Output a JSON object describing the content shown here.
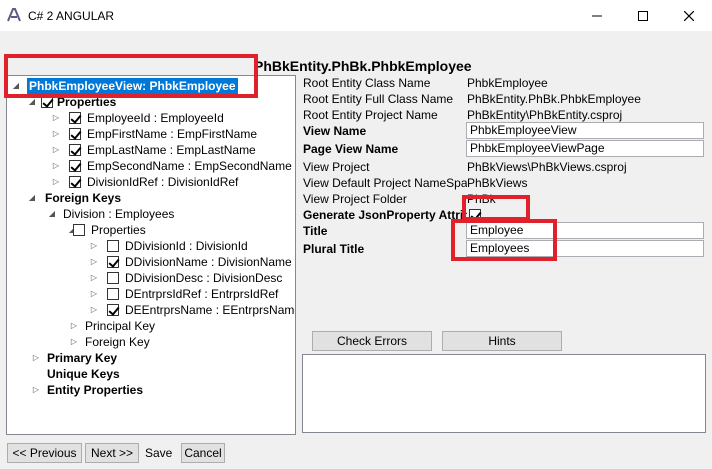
{
  "window": {
    "title": "C# 2 ANGULAR",
    "controls": {
      "minimize": "minimize-icon",
      "maximize": "maximize-icon",
      "close": "close-icon"
    }
  },
  "tree": {
    "root": "PhbkEmployeeView: PhbkEmployee",
    "properties_label": "Properties",
    "properties": [
      "EmployeeId : EmployeeId",
      "EmpFirstName : EmpFirstName",
      "EmpLastName : EmpLastName",
      "EmpSecondName : EmpSecondName",
      "DivisionIdRef : DivisionIdRef"
    ],
    "foreign_keys_label": "Foreign Keys",
    "division_label": "Division : Employees",
    "division_properties_label": "Properties",
    "division_properties": [
      {
        "label": "DDivisionId : DivisionId",
        "checked": false
      },
      {
        "label": "DDivisionName : DivisionName",
        "checked": true
      },
      {
        "label": "DDivisionDesc : DivisionDesc",
        "checked": false
      },
      {
        "label": "DEntrprsIdRef : EntrprsIdRef",
        "checked": false
      },
      {
        "label": "DEEntrprsName : EEntrprsName",
        "checked": true
      }
    ],
    "principal_key_label": "Principal Key",
    "division_foreign_key_label": "Foreign Key",
    "primary_key_label": "Primary Key",
    "unique_keys_label": "Unique Keys",
    "entity_properties_label": "Entity Properties"
  },
  "details": {
    "header": "PhBkEntity.PhBk.PhbkEmployee",
    "root_entity_class_name_label": "Root Entity Class Name",
    "root_entity_class_name": "PhbkEmployee",
    "root_entity_full_class_name_label": "Root Entity Full Class Name",
    "root_entity_full_class_name": "PhBkEntity.PhBk.PhbkEmployee",
    "root_entity_project_name_label": "Root Entity Project Name",
    "root_entity_project_name": "PhBkEntity\\PhBkEntity.csproj",
    "view_name_label": "View Name",
    "view_name": "PhbkEmployeeView",
    "page_view_name_label": "Page View Name",
    "page_view_name": "PhbkEmployeeViewPage",
    "view_project_label": "View Project",
    "view_project": "PhBkViews\\PhBkViews.csproj",
    "view_default_project_namespace_label": "View Default Project NameSpace",
    "view_default_project_namespace": "PhBkViews",
    "view_project_folder_label": "View Project Folder",
    "view_project_folder": "PhBk",
    "generate_jsonproperty_label": "Generate JsonProperty Attribute",
    "generate_jsonproperty_checked": true,
    "title_label": "Title",
    "title_value": "Employee",
    "plural_title_label": "Plural Title",
    "plural_title_value": "Employees"
  },
  "actions": {
    "check_errors": "Check Errors",
    "hints": "Hints"
  },
  "footer": {
    "previous": "<< Previous",
    "next": "Next >>",
    "save": "Save",
    "cancel": "Cancel"
  },
  "colors": {
    "highlight": "#0078d7",
    "annotation_red": "#e0202b"
  }
}
